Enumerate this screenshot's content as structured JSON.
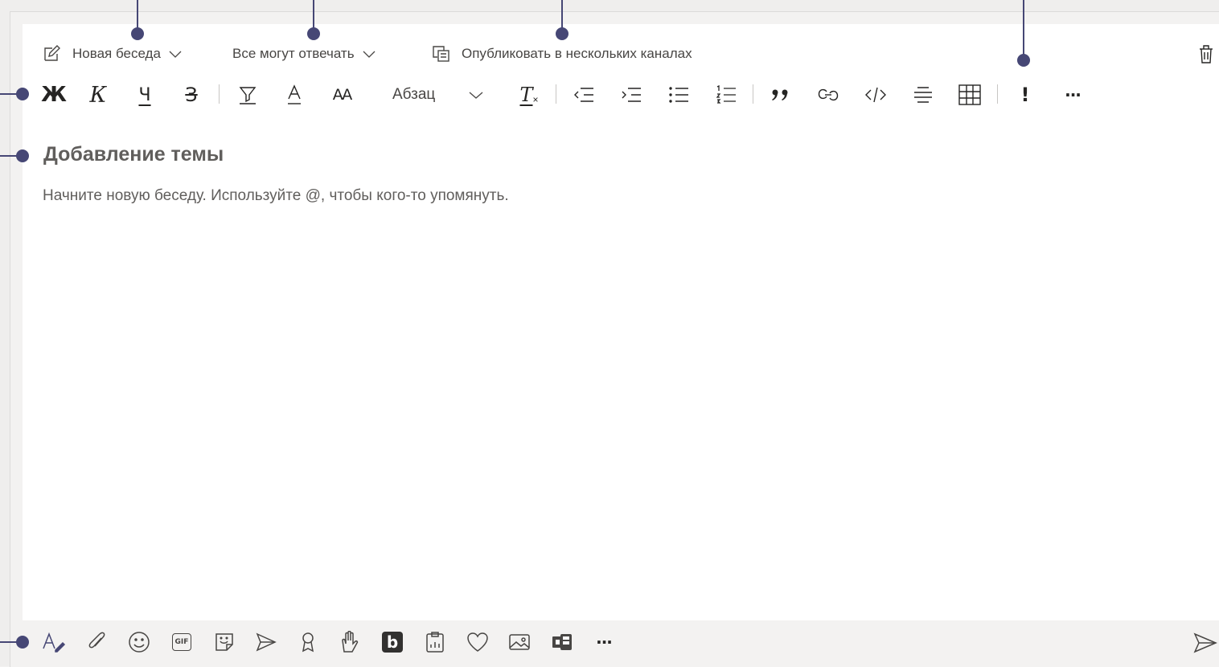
{
  "header": {
    "post_type_label": "Новая беседа",
    "reply_label": "Все могут отвечать",
    "multi_channel_label": "Опубликовать в нескольких каналах"
  },
  "format_toolbar": {
    "bold_glyph": "Ж",
    "italic_glyph": "К",
    "underline_glyph": "Ч",
    "strike_glyph": "З",
    "font_size_glyph": "AA",
    "paragraph_label": "Абзац",
    "clear_glyph": "T",
    "important_glyph": "!",
    "more_glyph": "···"
  },
  "editor": {
    "subject_placeholder": "Добавление темы",
    "body_placeholder": "Начните новую беседу. Используйте @, чтобы кого-то упомянуть."
  },
  "bottom_toolbar": {
    "gif_label": "GIF",
    "more_glyph": "···"
  },
  "colors": {
    "callout": "#464775",
    "icon": "#484644"
  }
}
